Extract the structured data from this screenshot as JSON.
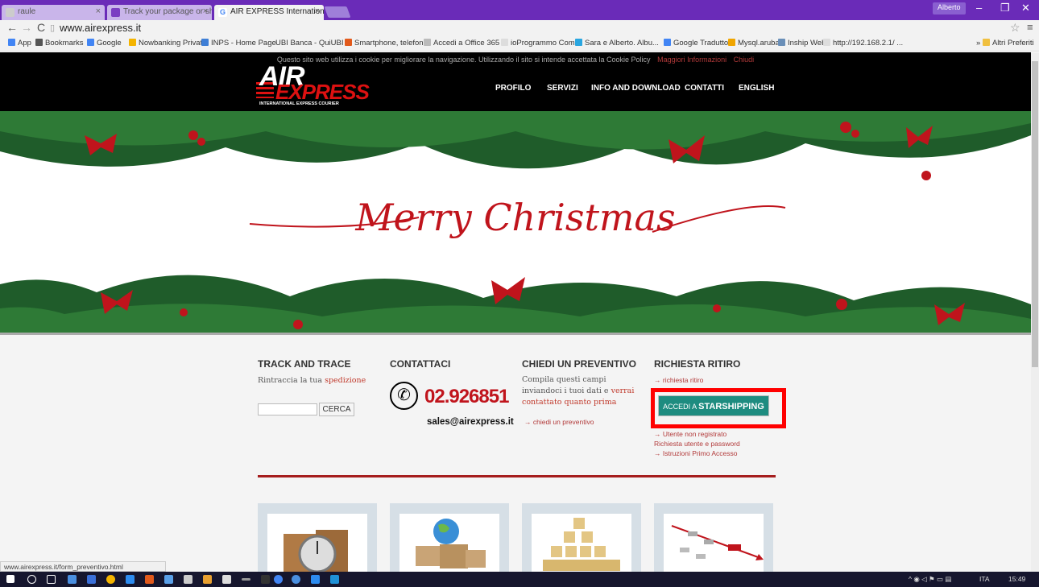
{
  "browser": {
    "tabs": [
      {
        "title": "raule"
      },
      {
        "title": "Track your package or shi"
      },
      {
        "title": "AIR EXPRESS Internationa"
      }
    ],
    "user": "Alberto",
    "url": "www.airexpress.it",
    "bookmarks": [
      "App",
      "Bookmarks",
      "Google",
      "Nowbanking Privati",
      "INPS - Home Page",
      "UBI Banca - QuiUBI",
      "Smartphone, telefon...",
      "Accedi a Office 365",
      "ioProgrammo Com...",
      "Sara e Alberto. Albu...",
      "Google Traduttore",
      "Mysql.aruba.it",
      "Inship Web",
      "http://192.168.2.1/ ...",
      "Altri Preferiti"
    ],
    "status_url": "www.airexpress.it/form_preventivo.html"
  },
  "cookie_bar": {
    "text": "Questo sito web utilizza i cookie per migliorare la navigazione. Utilizzando il sito si intende accettata la Cookie Policy",
    "more": "Maggiori Informazioni",
    "close": "Chiudi"
  },
  "header": {
    "logo_top": "AIR",
    "logo_bottom": "EXPRESS",
    "logo_sub": "INTERNATIONAL EXPRESS COURIER",
    "nav": [
      "PROFILO",
      "SERVIZI",
      "INFO AND DOWNLOAD",
      "CONTATTI",
      "ENGLISH"
    ]
  },
  "banner": {
    "text": "Merry Christmas"
  },
  "track": {
    "title": "TRACK AND TRACE",
    "text": "Rintraccia la tua",
    "link": "spedizione",
    "button": "CERCA"
  },
  "contact": {
    "title": "CONTATTACI",
    "phone": "02.926851",
    "email": "sales@airexpress.it"
  },
  "quote": {
    "title": "CHIEDI UN PREVENTIVO",
    "text1": "Compila questi campi inviandoci i tuoi dati e",
    "text2": "verrai contattato quanto prima",
    "link": "→ chiedi un preventivo"
  },
  "pickup": {
    "title": "RICHIESTA RITIRO",
    "link1": "→ richiesta ritiro",
    "btn_small": "ACCEDI A",
    "btn_big": "STARSHIPPING",
    "link2": "→ Utente non registrato",
    "link3": "Richiesta utente e password",
    "link4": "→ Istruzioni Primo Accesso"
  },
  "taskbar": {
    "lang": "ITA",
    "time": "15:49"
  },
  "colors": {
    "tab_bar": "#6a2bb8",
    "brand_red": "#c0141c",
    "button_teal": "#1e8c80",
    "highlight": "#ff0000"
  }
}
